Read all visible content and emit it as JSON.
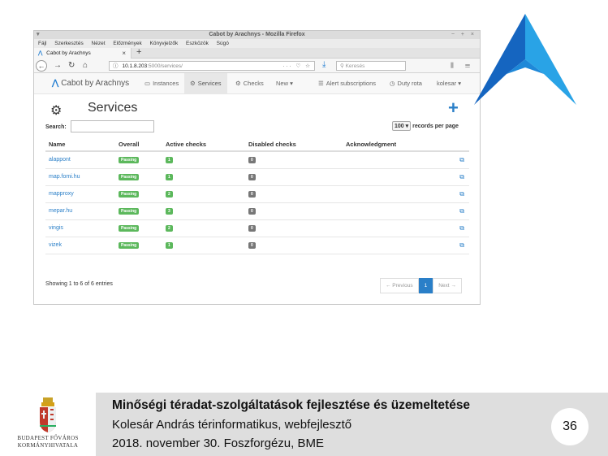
{
  "browser": {
    "window_title": "Cabot by Arachnys - Mozilla Firefox",
    "window_controls": "− + ×",
    "menu": [
      "Fájl",
      "Szerkesztés",
      "Nézet",
      "Előzmények",
      "Könyvjelzők",
      "Eszközök",
      "Súgó"
    ],
    "tab_label": "Cabot by Arachnys",
    "tab_close": "×",
    "new_tab": "+",
    "url_host": "10.1.8.203",
    "url_path": ":5000/services/",
    "url_icons": "··· ♡ ☆",
    "search_placeholder": "Keresés",
    "toolbar_icons": "⫼ ☰"
  },
  "app": {
    "brand": "Cabot by Arachnys",
    "nav": [
      {
        "label": "Instances",
        "icon": "monitor-icon"
      },
      {
        "label": "Services",
        "icon": "cogs-icon"
      },
      {
        "label": "Checks",
        "icon": "gear-icon"
      },
      {
        "label": "New ▾",
        "icon": ""
      },
      {
        "label": "Alert subscriptions",
        "icon": "list-icon"
      },
      {
        "label": "Duty rota",
        "icon": "clock-icon"
      },
      {
        "label": "kolesar ▾",
        "icon": ""
      }
    ]
  },
  "page": {
    "title": "Services",
    "search_label": "Search:",
    "records_value": "100 ▾",
    "records_label": "records per page",
    "columns": [
      "Name",
      "Overall",
      "Active checks",
      "Disabled checks",
      "Acknowledgment"
    ],
    "rows": [
      {
        "name": "alappont",
        "overall": "Passing",
        "active": "1",
        "disabled": "0"
      },
      {
        "name": "map.fomi.hu",
        "overall": "Passing",
        "active": "1",
        "disabled": "0"
      },
      {
        "name": "mapproxy",
        "overall": "Passing",
        "active": "2",
        "disabled": "0"
      },
      {
        "name": "mepar.hu",
        "overall": "Passing",
        "active": "3",
        "disabled": "0"
      },
      {
        "name": "vingis",
        "overall": "Passing",
        "active": "2",
        "disabled": "0"
      },
      {
        "name": "vizek",
        "overall": "Passing",
        "active": "1",
        "disabled": "0"
      }
    ],
    "showing": "Showing 1 to 6 of 6 entries",
    "pager": {
      "prev": "← Previous",
      "current": "1",
      "next": "Next →"
    }
  },
  "footer": {
    "org_line1": "BUDAPEST FŐVÁROS",
    "org_line2": "KORMÁNYHIVATALA",
    "title": "Minőségi téradat-szolgáltatások fejlesztése és üzemeltetése",
    "author": "Kolesár András térinformatikus, webfejlesztő",
    "event": "2018. november 30. Foszforgézu, BME",
    "page_number": "36"
  },
  "colors": {
    "accent_blue": "#2a7fc8",
    "logo_dark": "#1565c0",
    "logo_light": "#29a3e6",
    "passing_green": "#5cb85c",
    "footer_bg": "#dedede"
  }
}
